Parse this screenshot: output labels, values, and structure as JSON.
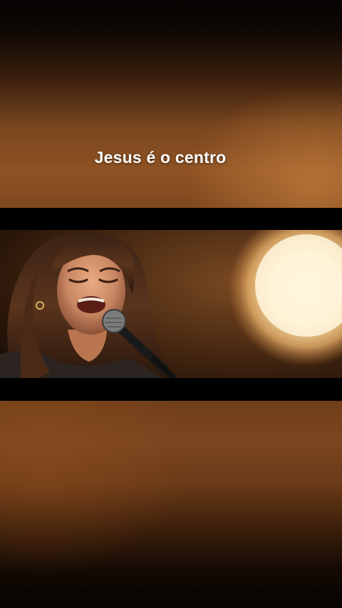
{
  "caption": {
    "text": "Jesus é o centro",
    "color": "#ffffff"
  },
  "scene": {
    "description_icon": "singer-with-microphone",
    "light_color": "#fff3d6",
    "bar_color": "#000000"
  }
}
